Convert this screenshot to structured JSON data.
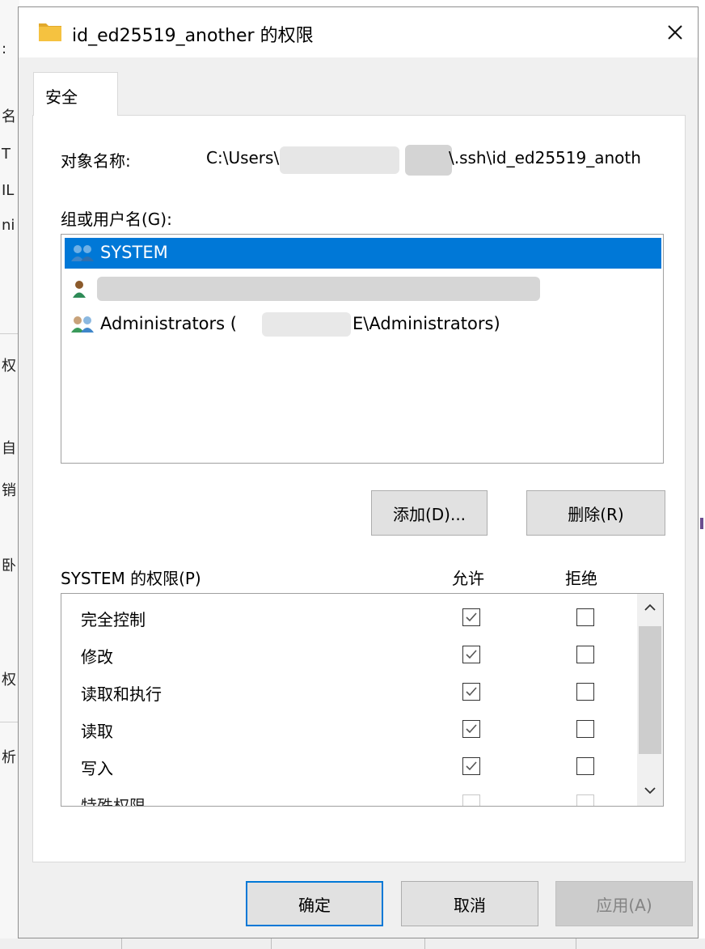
{
  "background_window": {
    "fragments": [
      ":",
      "名",
      "T",
      "IL",
      "ni",
      "权",
      "自",
      "销",
      "卧",
      "权",
      "析"
    ]
  },
  "dialog": {
    "title": "id_ed25519_another 的权限",
    "tab_label": "安全",
    "object_name_label": "对象名称:",
    "object_path_start": "C:\\Users\\",
    "object_path_end": "\\.ssh\\id_ed25519_anoth",
    "group_label": "组或用户名(G):",
    "users": [
      {
        "name": "SYSTEM",
        "selected": true,
        "icon": "group-users-icon"
      },
      {
        "name": "",
        "selected": false,
        "icon": "user-icon"
      },
      {
        "name": "Administrators (",
        "name_tail": "E\\Administrators)",
        "selected": false,
        "icon": "group-users-icon"
      }
    ],
    "add_button": "添加(D)...",
    "remove_button": "删除(R)",
    "permissions_label": "SYSTEM 的权限(P)",
    "allow_header": "允许",
    "deny_header": "拒绝",
    "permissions": [
      {
        "name": "完全控制",
        "allow": true,
        "deny": false
      },
      {
        "name": "修改",
        "allow": true,
        "deny": false
      },
      {
        "name": "读取和执行",
        "allow": true,
        "deny": false
      },
      {
        "name": "读取",
        "allow": true,
        "deny": false
      },
      {
        "name": "写入",
        "allow": true,
        "deny": false
      },
      {
        "name": "特殊权限",
        "allow": false,
        "deny": false
      }
    ],
    "ok_button": "确定",
    "cancel_button": "取消",
    "apply_button": "应用(A)"
  },
  "colors": {
    "selection": "#0078d7",
    "dialog_bg": "#f0f0f0",
    "folder_icon": "#f5c240"
  }
}
